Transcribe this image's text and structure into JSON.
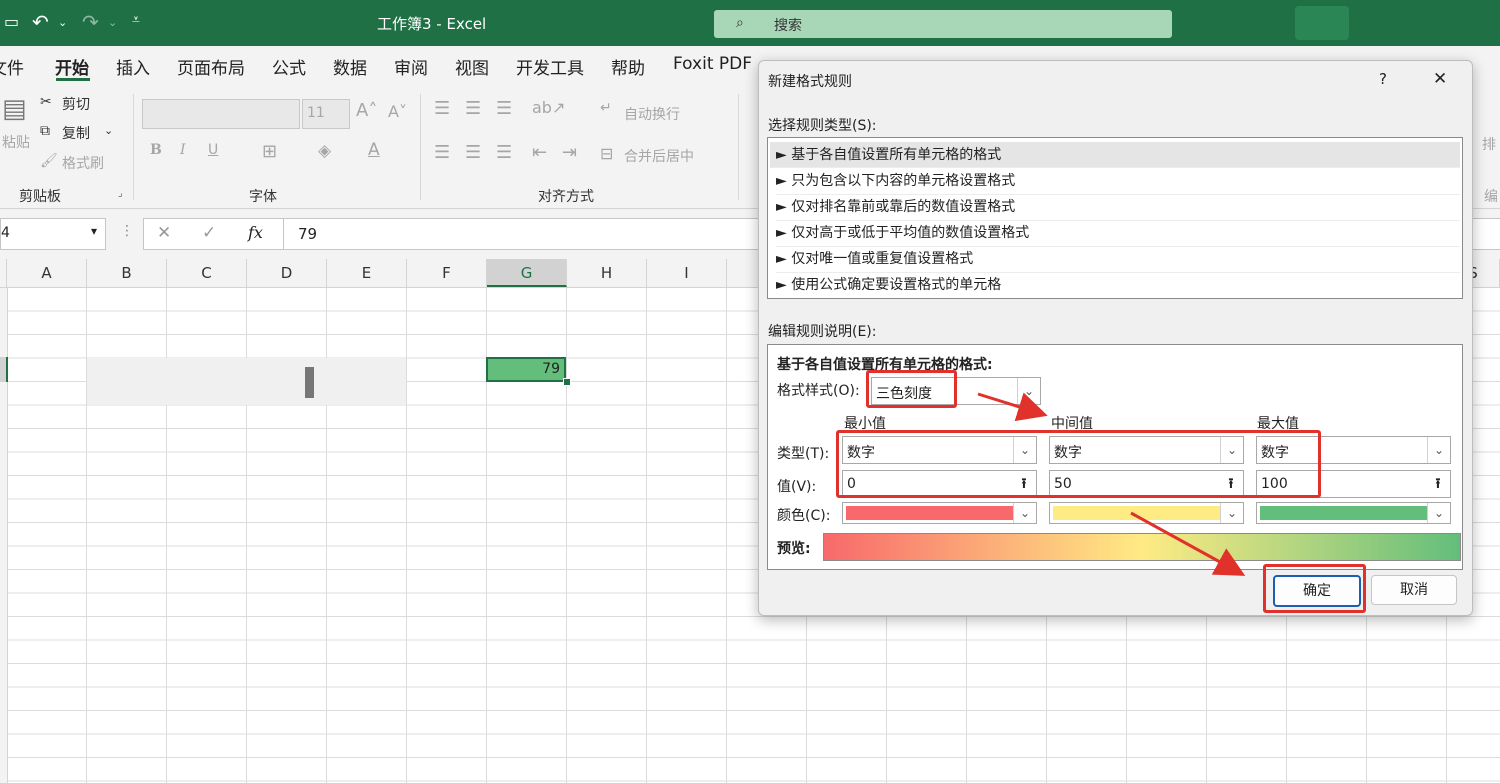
{
  "titlebar": {
    "title": "工作簿3  -  Excel",
    "search_placeholder": "搜索"
  },
  "menu": [
    "文件",
    "开始",
    "插入",
    "页面布局",
    "公式",
    "数据",
    "审阅",
    "视图",
    "开发工具",
    "帮助",
    "Foxit PDF"
  ],
  "menu_shown": [
    "文件",
    "开始",
    "插入",
    "页面布局",
    "公式",
    "数据",
    "审阅",
    "视图",
    "开发工具",
    "帮助",
    "Foxit PDF"
  ],
  "ribbon": {
    "clipboard": {
      "paste": "粘贴",
      "cut": "剪切",
      "copy": "复制",
      "format_painter": "格式刷",
      "group": "剪贴板"
    },
    "font": {
      "size": "11",
      "bold": "B",
      "italic": "I",
      "underline": "U",
      "group": "字体"
    },
    "alignment": {
      "wrap": "自动换行",
      "merge": "合并后居中",
      "group": "对齐方式"
    },
    "right_label_1": "排",
    "right_label_2": "编"
  },
  "formula_bar": {
    "name_box": "4",
    "content": "79",
    "fx": "fx"
  },
  "columns": [
    "A",
    "B",
    "C",
    "D",
    "E",
    "F",
    "G",
    "H",
    "I",
    "S"
  ],
  "cell_g": "79",
  "dialog": {
    "title": "新建格式规则",
    "help": "?",
    "close": "✕",
    "rule_type_label": "选择规则类型(S):",
    "rule_types": [
      "► 基于各自值设置所有单元格的格式",
      "► 只为包含以下内容的单元格设置格式",
      "► 仅对排名靠前或靠后的数值设置格式",
      "► 仅对高于或低于平均值的数值设置格式",
      "► 仅对唯一值或重复值设置格式",
      "► 使用公式确定要设置格式的单元格"
    ],
    "edit_label": "编辑规则说明(E):",
    "edit_heading": "基于各自值设置所有单元格的格式:",
    "format_style_label": "格式样式(O):",
    "format_style_value": "三色刻度",
    "col_min": "最小值",
    "col_mid": "中间值",
    "col_max": "最大值",
    "type_label": "类型(T):",
    "value_label": "值(V):",
    "color_label": "颜色(C):",
    "preview_label": "预览:",
    "min": {
      "type": "数字",
      "value": "0",
      "color": "#f8696b"
    },
    "mid": {
      "type": "数字",
      "value": "50",
      "color": "#ffeb84"
    },
    "max": {
      "type": "数字",
      "value": "100",
      "color": "#63be7b"
    },
    "ok": "确定",
    "cancel": "取消"
  }
}
